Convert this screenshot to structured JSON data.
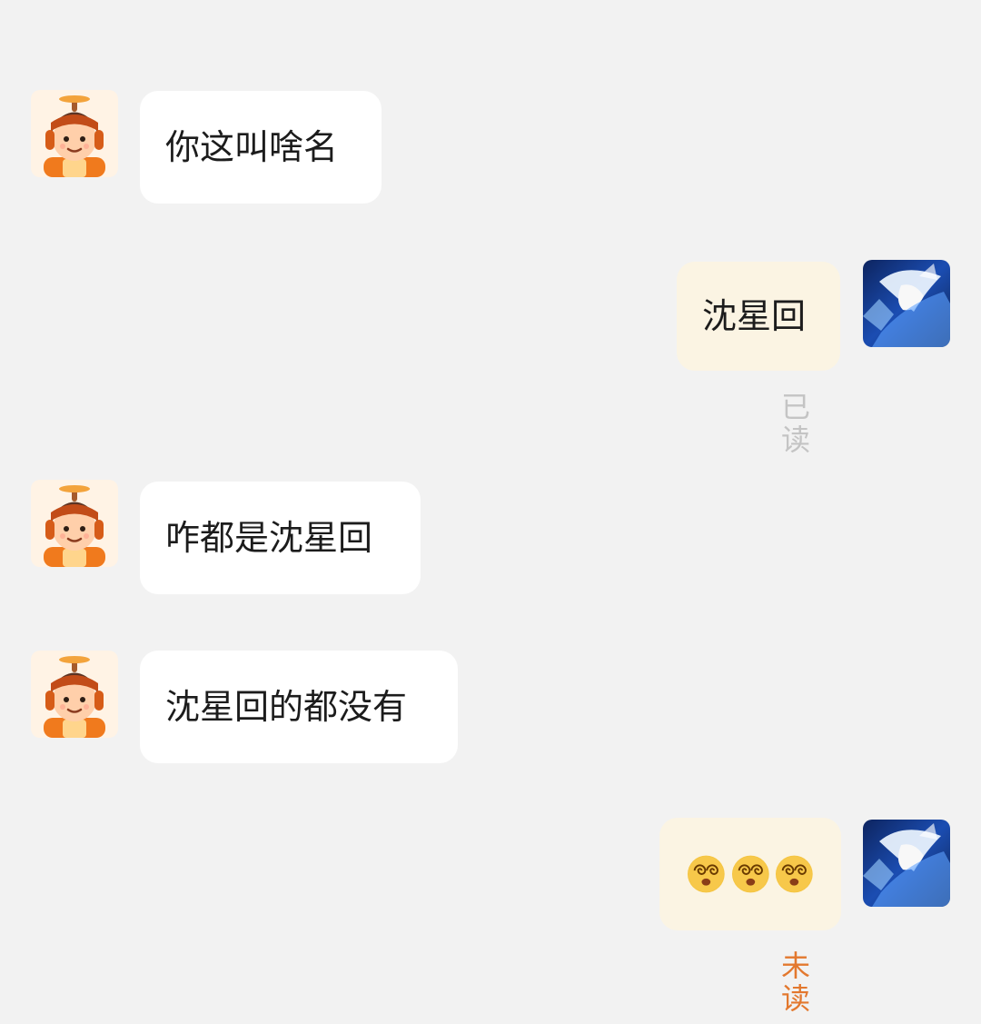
{
  "header": {
    "title": ""
  },
  "messages": [
    {
      "sender": "contact",
      "text": "你这叫啥名"
    },
    {
      "sender": "me",
      "text": "沈星回",
      "status": "已读"
    },
    {
      "sender": "contact",
      "text": "咋都是沈星回"
    },
    {
      "sender": "contact",
      "text": "沈星回的都没有"
    },
    {
      "sender": "me",
      "emoji_count": 3,
      "emoji": "dizzy-face-emoji",
      "status": "未读"
    }
  ],
  "avatars": {
    "contact": "propeller-hat-boy-avatar",
    "me": "anime-character-avatar"
  },
  "colors": {
    "background": "#f2f2f2",
    "incoming_bubble": "#ffffff",
    "outgoing_bubble": "#fbf4e3",
    "read_status": "#c4c4c4",
    "unread_status": "#e3782e"
  }
}
